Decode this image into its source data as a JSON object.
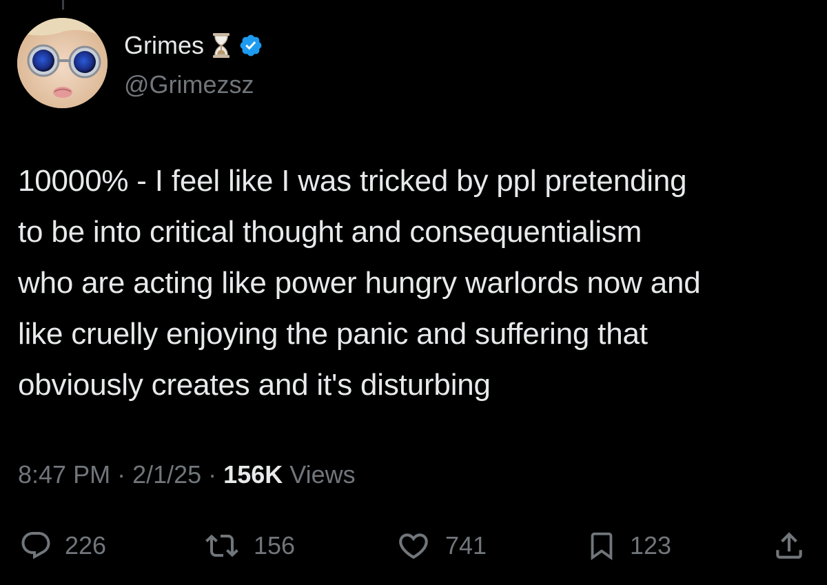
{
  "author": {
    "display_name": "Grimes",
    "handle": "@Grimezsz",
    "badge_icon": "hourglass-icon",
    "verified_icon": "verified-icon",
    "verified_color": "#1d9bf0"
  },
  "tweet": {
    "text": "10000% - I feel like I was tricked by ppl pretending\nto be into critical thought and consequentialism\nwho are acting like power hungry warlords now and\nlike cruelly enjoying the panic and suffering that\nobviously creates and it's disturbing"
  },
  "meta": {
    "time": "8:47 PM",
    "separator": "·",
    "date": "2/1/25",
    "views_count": "156K",
    "views_label": "Views"
  },
  "actions": {
    "replies": "226",
    "reposts": "156",
    "likes": "741",
    "bookmarks": "123"
  },
  "colors": {
    "background": "#000000",
    "text_primary": "#e7e9ea",
    "text_secondary": "#71767b"
  }
}
